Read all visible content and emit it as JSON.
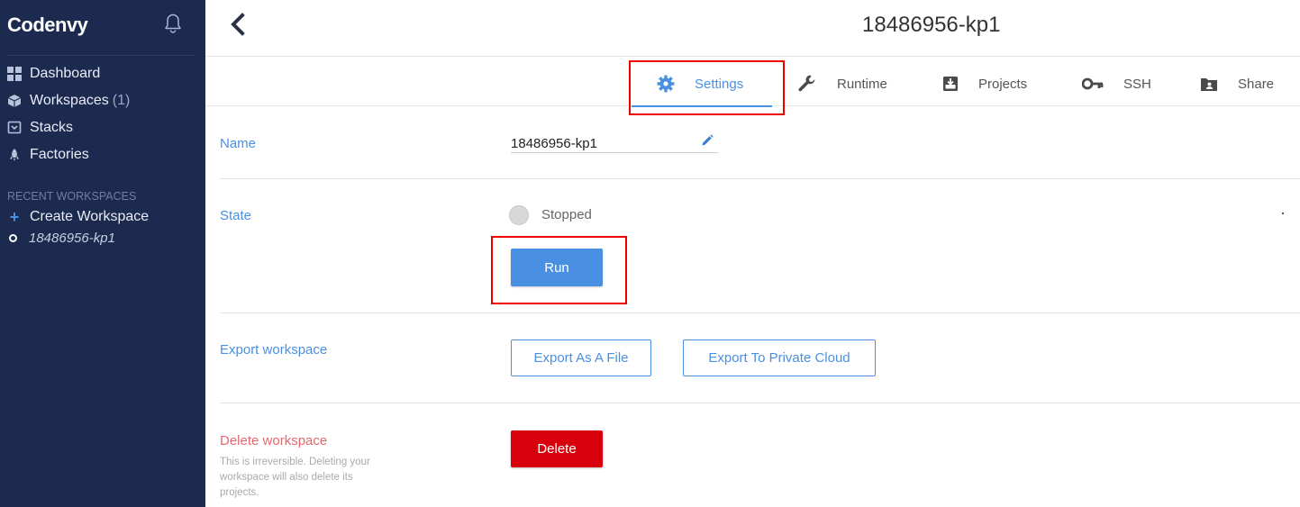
{
  "sidebar": {
    "logo": "Codenvy",
    "nav": [
      {
        "label": "Dashboard",
        "icon": "dashboard-icon"
      },
      {
        "label": "Workspaces",
        "count": "(1)",
        "icon": "cube-icon"
      },
      {
        "label": "Stacks",
        "icon": "stack-icon"
      },
      {
        "label": "Factories",
        "icon": "rocket-icon"
      }
    ],
    "recent_title": "RECENT WORKSPACES",
    "create_workspace": "Create Workspace",
    "recent_workspace": "18486956-kp1"
  },
  "header": {
    "title": "18486956-kp1"
  },
  "tabs": [
    {
      "label": "Settings",
      "icon": "gear-icon",
      "active": true
    },
    {
      "label": "Runtime",
      "icon": "wrench-icon"
    },
    {
      "label": "Projects",
      "icon": "download-box-icon"
    },
    {
      "label": "SSH",
      "icon": "key-icon"
    },
    {
      "label": "Share",
      "icon": "folder-user-icon"
    }
  ],
  "settings": {
    "name_label": "Name",
    "name_value": "18486956-kp1",
    "state_label": "State",
    "state_value": "Stopped",
    "run_label": "Run",
    "export_label": "Export workspace",
    "export_file_label": "Export As A File",
    "export_cloud_label": "Export To Private Cloud",
    "delete_label": "Delete workspace",
    "delete_description": "This is irreversible. Deleting your workspace will also delete its projects.",
    "delete_button": "Delete"
  },
  "colors": {
    "sidebar_bg": "#1c2a4f",
    "accent": "#4a90e2",
    "danger": "#d9000d",
    "highlight": "#e00000"
  }
}
